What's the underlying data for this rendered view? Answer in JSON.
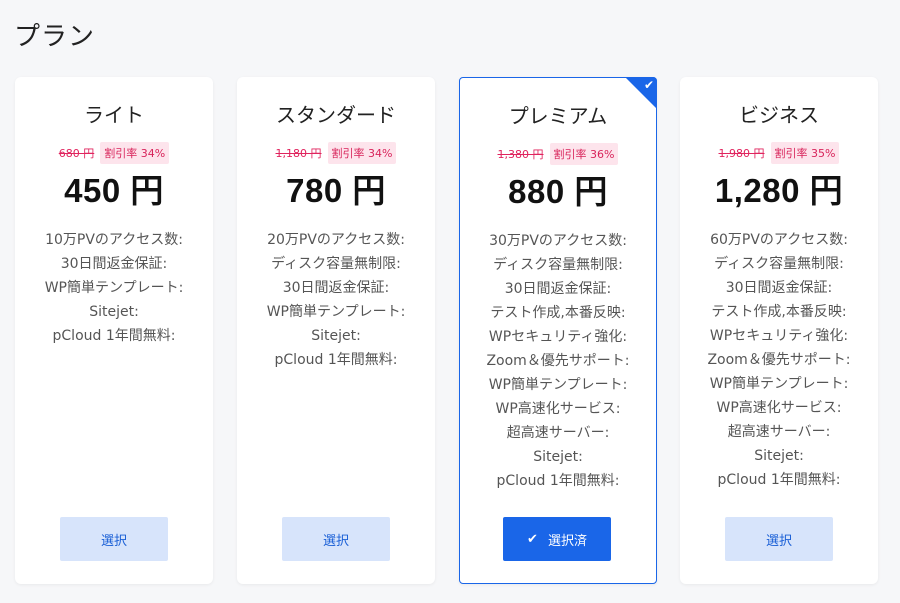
{
  "page": {
    "title": "プラン"
  },
  "plans": [
    {
      "name": "ライト",
      "old_price": "680 円",
      "discount": "割引率 34%",
      "price": "450 円",
      "features": [
        "10万PVのアクセス数:",
        "30日間返金保証:",
        "WP簡単テンプレート:",
        "Sitejet:",
        "pCloud 1年間無料:"
      ],
      "button_label": "選択",
      "selected": false
    },
    {
      "name": "スタンダード",
      "old_price": "1,180 円",
      "discount": "割引率 34%",
      "price": "780 円",
      "features": [
        "20万PVのアクセス数:",
        "ディスク容量無制限:",
        "30日間返金保証:",
        "WP簡単テンプレート:",
        "Sitejet:",
        "pCloud 1年間無料:"
      ],
      "button_label": "選択",
      "selected": false
    },
    {
      "name": "プレミアム",
      "old_price": "1,380 円",
      "discount": "割引率 36%",
      "price": "880 円",
      "features": [
        "30万PVのアクセス数:",
        "ディスク容量無制限:",
        "30日間返金保証:",
        "テスト作成,本番反映:",
        "WPセキュリティ強化:",
        "Zoom＆優先サポート:",
        "WP簡単テンプレート:",
        "WP高速化サービス:",
        "超高速サーバー:",
        "Sitejet:",
        "pCloud 1年間無料:"
      ],
      "button_label": "選択済",
      "button_icon": "check-icon",
      "selected": true
    },
    {
      "name": "ビジネス",
      "old_price": "1,980 円",
      "discount": "割引率 35%",
      "price": "1,280 円",
      "features": [
        "60万PVのアクセス数:",
        "ディスク容量無制限:",
        "30日間返金保証:",
        "テスト作成,本番反映:",
        "WPセキュリティ強化:",
        "Zoom＆優先サポート:",
        "WP簡単テンプレート:",
        "WP高速化サービス:",
        "超高速サーバー:",
        "Sitejet:",
        "pCloud 1年間無料:"
      ],
      "button_label": "選択",
      "selected": false
    }
  ],
  "colors": {
    "accent": "#1a66e8",
    "button_light": "#d7e4fb",
    "discount_text": "#d8235a",
    "discount_bg": "#fde4ec"
  }
}
